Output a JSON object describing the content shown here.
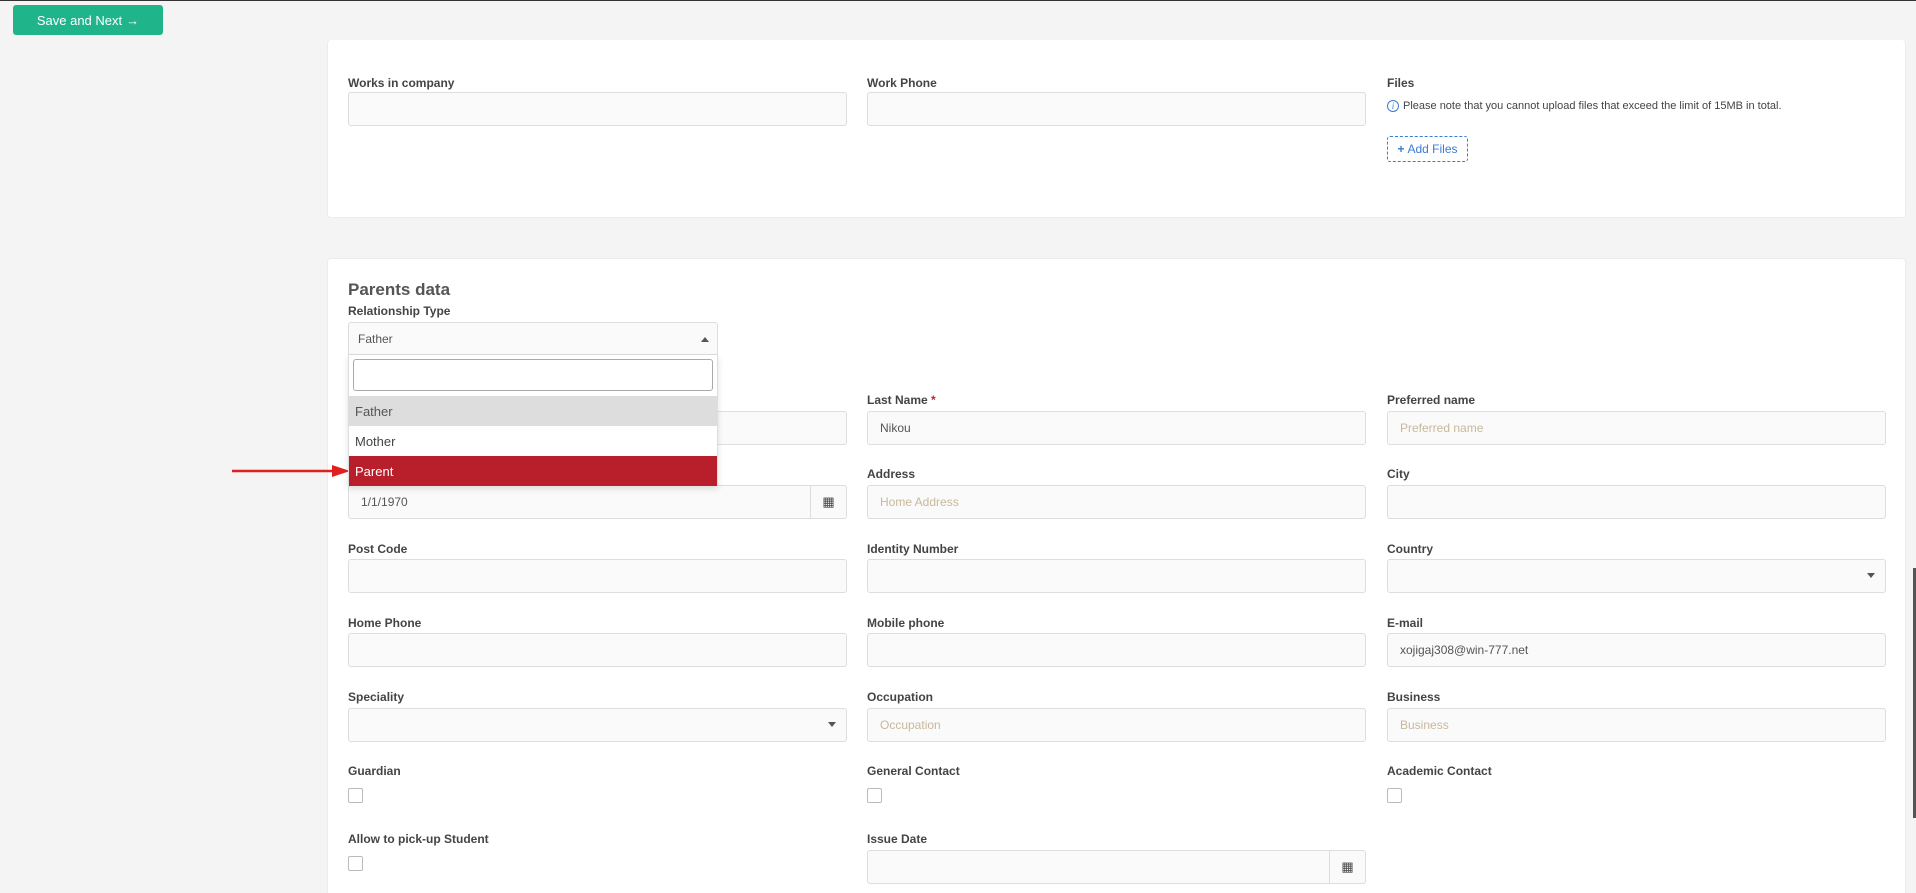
{
  "toolbar": {
    "save_next_label": "Save and Next",
    "save_next_arrow": "→"
  },
  "card1": {
    "works_in_company_label": "Works in company",
    "work_phone_label": "Work Phone",
    "files_label": "Files",
    "files_note": "Please note that you cannot upload files that exceed the limit of 15MB in total.",
    "add_files_label": "Add Files"
  },
  "parents": {
    "section_title": "Parents data",
    "relationship_type_label": "Relationship Type",
    "relationship_value": "Father",
    "relationship_options": [
      "Father",
      "Mother",
      "Parent"
    ],
    "last_name_label": "Last Name",
    "last_name_required": "*",
    "last_name_value": "Nikou",
    "preferred_name_label": "Preferred name",
    "preferred_name_placeholder": "Preferred name",
    "birth_date_value": "1/1/1970",
    "address_label": "Address",
    "address_placeholder": "Home Address",
    "city_label": "City",
    "post_code_label": "Post Code",
    "identity_number_label": "Identity Number",
    "country_label": "Country",
    "home_phone_label": "Home Phone",
    "mobile_phone_label": "Mobile phone",
    "email_label": "E-mail",
    "email_value": "xojigaj308@win-777.net",
    "speciality_label": "Speciality",
    "occupation_label": "Occupation",
    "occupation_placeholder": "Occupation",
    "business_label": "Business",
    "business_placeholder": "Business",
    "guardian_label": "Guardian",
    "general_contact_label": "General Contact",
    "academic_contact_label": "Academic Contact",
    "allow_pickup_label": "Allow to pick-up Student",
    "issue_date_label": "Issue Date"
  },
  "icons": {
    "calendar": "calendar-icon",
    "info": "info-icon",
    "plus": "plus-icon",
    "arrow": "red-arrow-annotation"
  },
  "colors": {
    "primary_button": "#1fb48a",
    "highlight_option": "#b91f2b",
    "link_blue": "#3a7bd5",
    "annotation_red": "#e02020"
  }
}
